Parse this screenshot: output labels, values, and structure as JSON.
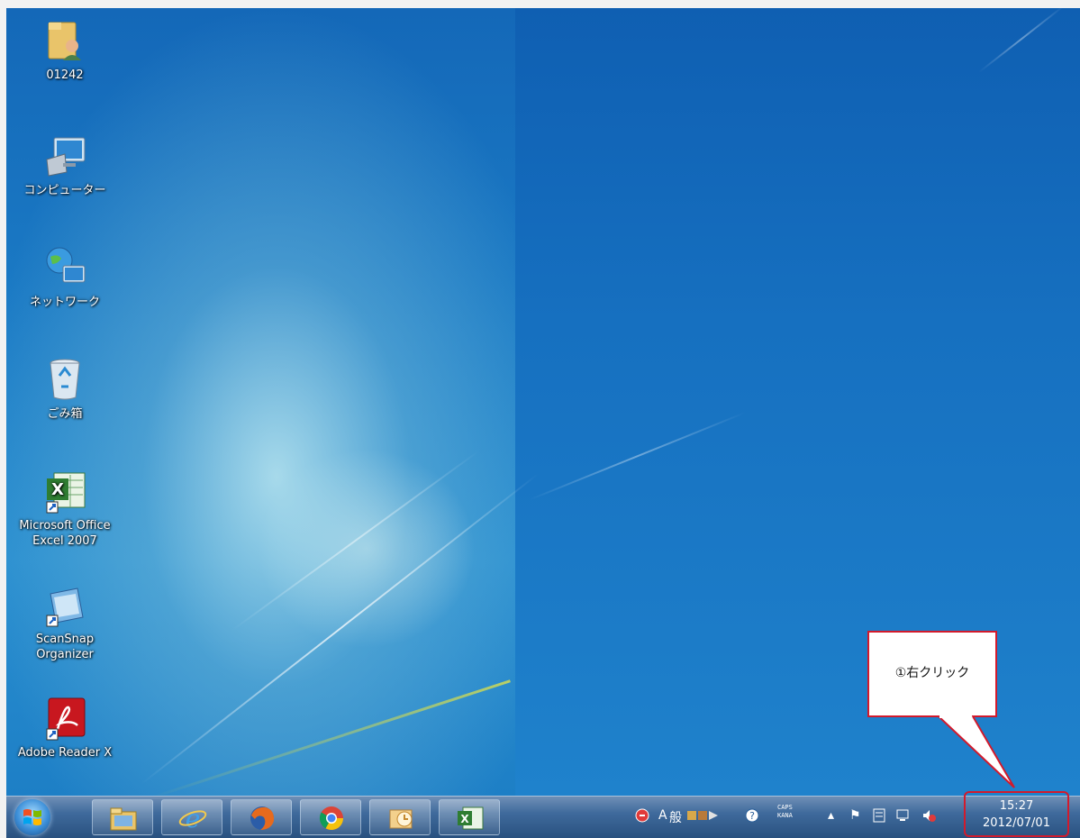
{
  "desktop": {
    "icons": [
      {
        "label": "01242",
        "icon": "user-folder-icon"
      },
      {
        "label": "コンピューター",
        "icon": "computer-icon"
      },
      {
        "label": "ネットワーク",
        "icon": "network-icon"
      },
      {
        "label": "ごみ箱",
        "icon": "recycle-bin-icon"
      },
      {
        "label": "Microsoft Office\nExcel 2007",
        "icon": "excel-icon"
      },
      {
        "label": "ScanSnap\nOrganizer",
        "icon": "scansnap-icon"
      },
      {
        "label": "Adobe Reader X",
        "icon": "adobe-reader-icon"
      }
    ]
  },
  "callout": {
    "text": "①右クリック",
    "border_color": "#d21a2c"
  },
  "taskbar": {
    "pinned": [
      "explorer-icon",
      "internet-explorer-icon",
      "firefox-icon",
      "chrome-icon",
      "outlook-icon",
      "excel-icon"
    ],
    "tray": {
      "ime_mode": "A",
      "ime_kanji": "般",
      "caps": "CAPS",
      "kana": "KANA"
    },
    "clock": {
      "time": "15:27",
      "date": "2012/07/01"
    }
  }
}
